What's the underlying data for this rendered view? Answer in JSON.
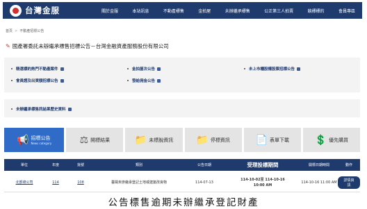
{
  "header": {
    "logo_text": "台灣金服",
    "nav": [
      "關於金服",
      "本站訊息",
      "不動產標售",
      "金拍屋",
      "未辦繼承標售",
      "公正第三人拍賣",
      "競標標的",
      "會員專區"
    ]
  },
  "breadcrumb": [
    "首頁",
    "不動產招標公告"
  ],
  "page_title": "國產署委託未辦繼承標售招標公告－台灣金融資產服務股份有限公司",
  "quick_links": {
    "col1": [
      "精選標的熱門不動產案件",
      "會員證及出資額招標公告"
    ],
    "col2": [
      "金拍屋次公告",
      "發給佣金公告"
    ],
    "col3": [
      "未上市櫃股權股票招標公告"
    ],
    "history": "未辦繼承標售訊結果歷史資料"
  },
  "tabs": [
    {
      "label": "招標公告",
      "sub": "News category",
      "icon": "megaphone-icon",
      "glyph": "📢"
    },
    {
      "label": "開標結果",
      "sub": "",
      "icon": "gavel-icon",
      "glyph": "⚖"
    },
    {
      "label": "未標脫資訊",
      "sub": "",
      "icon": "folder-icon",
      "glyph": "📁"
    },
    {
      "label": "停標資訊",
      "sub": "",
      "icon": "folder-icon",
      "glyph": "📁"
    },
    {
      "label": "表單下載",
      "sub": "",
      "icon": "document-icon",
      "glyph": "📄"
    },
    {
      "label": "優先購買",
      "sub": "",
      "icon": "dollar-icon",
      "glyph": "💲"
    }
  ],
  "table": {
    "headers": [
      "單位",
      "年度",
      "批號",
      "類別",
      "公告日期",
      "受理投標期間",
      "開標日期時間",
      "動作"
    ],
    "row": {
      "unit": "北部總公司",
      "year": "114",
      "batch": "108",
      "category": "臺閩未辦繼承登記土地或建築改良物",
      "notice_date": "114-07-13",
      "period_line1": "114-10-02至 114-10-16",
      "period_line2": "10:00 AM",
      "open_datetime": "114-10-16 11:00 AM",
      "action": "詳情資訊"
    }
  },
  "caption": "公告標售逾期未辦繼承登記財產",
  "colors": {
    "navy": "#1f3b6e",
    "accent_blue": "#2f6bc7",
    "panel_gray": "#f3f3f3"
  }
}
